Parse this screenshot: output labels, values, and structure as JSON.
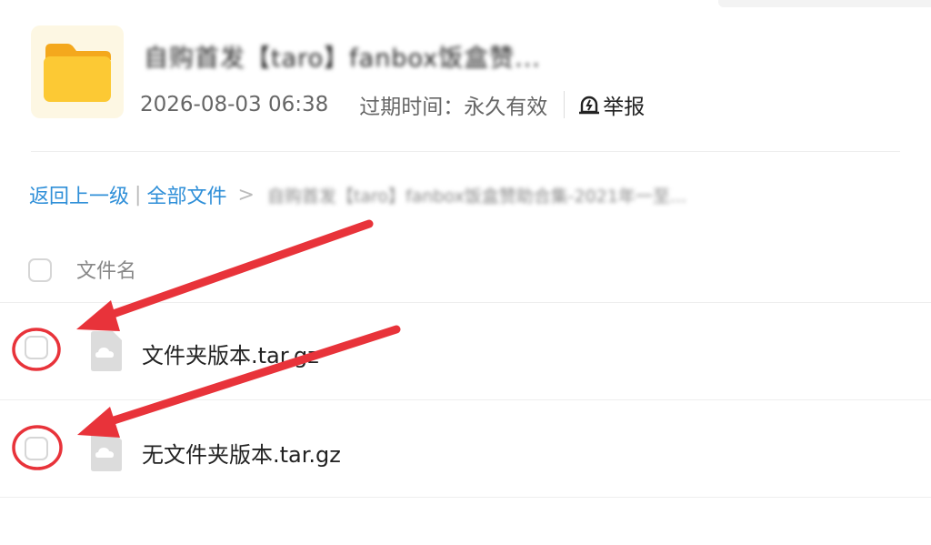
{
  "share": {
    "title": "自购首发【taro】fanbox饭盒赞...",
    "date": "2026-08-03 06:38",
    "expiry": "过期时间：永久有效",
    "report_label": "举报"
  },
  "breadcrumb": {
    "back": "返回上一级",
    "separator": "|",
    "all_files": "全部文件",
    "chevron": ">",
    "current": "自购首发【taro】fanbox饭盒赞助合集-2021年一至..."
  },
  "list": {
    "column_name": "文件名",
    "files": [
      {
        "name": "文件夹版本.tar.gz"
      },
      {
        "name": "无文件夹版本.tar.gz"
      }
    ]
  },
  "colors": {
    "link": "#2f8fd8",
    "folder": "#fbc02d",
    "annotation": "#e8333a"
  },
  "icons": [
    "folder-icon",
    "report-icon",
    "cloud-file-icon"
  ]
}
